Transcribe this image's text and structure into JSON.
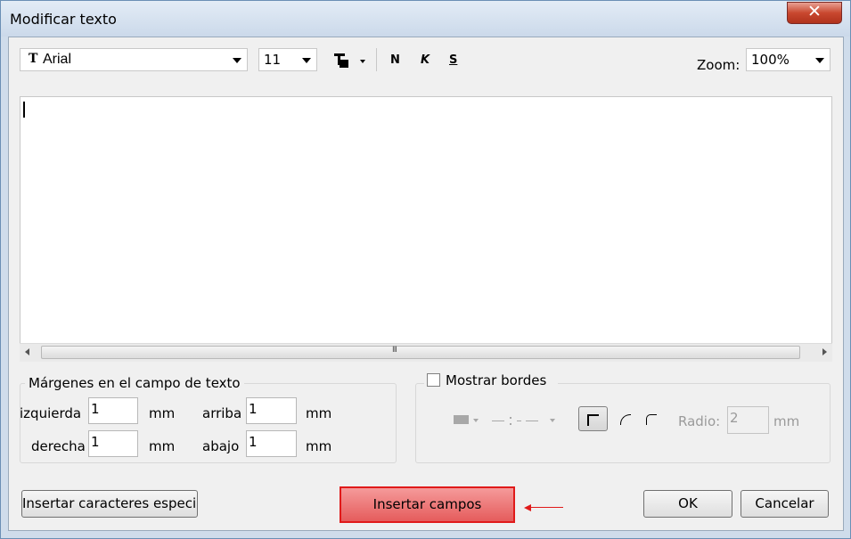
{
  "window": {
    "title": "Modificar texto",
    "close_glyph": "✕"
  },
  "toolbar": {
    "font_icon_glyph": "T",
    "font": "Arial",
    "size": "11",
    "bold": "N",
    "italic": "K",
    "strike": "S",
    "zoom_label": "Zoom:",
    "zoom_value": "100%"
  },
  "editor": {
    "text": ""
  },
  "scrollbar": {
    "grip": "III"
  },
  "margins": {
    "legend": "Márgenes en el campo de texto",
    "left_label": "izquierda",
    "left_value": "1",
    "right_label": "derecha",
    "right_value": "1",
    "top_label": "arriba",
    "top_value": "1",
    "bottom_label": "abajo",
    "bottom_value": "1",
    "unit": "mm"
  },
  "borders": {
    "checkbox_label": "Mostrar bordes",
    "checked": false,
    "radius_label": "Radio:",
    "radius_value": "2",
    "unit": "mm"
  },
  "buttons": {
    "special_chars": "Insertar caracteres especiales",
    "insert_fields": "Insertar campos",
    "ok": "OK",
    "cancel": "Cancelar"
  },
  "colors": {
    "highlight_red": "#e01a1a",
    "titlebar": "#cbd9ea"
  }
}
